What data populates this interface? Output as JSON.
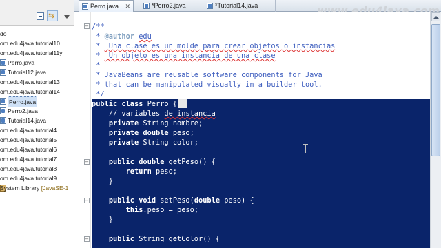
{
  "explorer": {
    "items": [
      {
        "label": "do",
        "icon": "none"
      },
      {
        "label": "om.edu4java.tutorial10",
        "icon": "package-icon"
      },
      {
        "label": "om.edu4java.tutorial11y",
        "icon": "package-icon"
      },
      {
        "label": "Perro.java",
        "icon": "java-file-icon"
      },
      {
        "label": "Tutorial12.java",
        "icon": "java-file-icon"
      },
      {
        "label": "om.edu4java.tutorial13",
        "icon": "package-icon"
      },
      {
        "label": "om.edu4java.tutorial14",
        "icon": "package-icon"
      },
      {
        "label": "Perro.java",
        "icon": "java-file-icon",
        "selected": true
      },
      {
        "label": "Perro2.java",
        "icon": "java-file-icon"
      },
      {
        "label": "Tutorial14.java",
        "icon": "java-file-icon"
      },
      {
        "label": "om.edu4java.tutorial4",
        "icon": "package-icon"
      },
      {
        "label": "om.edu4java.tutorial5",
        "icon": "package-icon"
      },
      {
        "label": "om.edu4java.tutorial6",
        "icon": "package-icon"
      },
      {
        "label": "om.edu4java.tutorial7",
        "icon": "package-icon"
      },
      {
        "label": "om.edu4java.tutorial8",
        "icon": "package-icon"
      },
      {
        "label": "om.edu4java.tutorial9",
        "icon": "package-icon"
      },
      {
        "label": "System Library",
        "icon": "library-icon",
        "suffix": "[JavaSE-1"
      }
    ]
  },
  "tabs": [
    {
      "label": "Perro.java",
      "close": "✕",
      "active": true
    },
    {
      "label": "*Perro2.java",
      "active": false
    },
    {
      "label": "*Tutorial14.java",
      "active": false
    }
  ],
  "watermark": "www.edu4java.com",
  "editor": {
    "lines": [
      {
        "segments": [
          {
            "t": "/**",
            "c": "comment"
          }
        ]
      },
      {
        "segments": [
          {
            "t": " * ",
            "c": "comment"
          },
          {
            "t": "@author",
            "c": "tag"
          },
          {
            "t": " ",
            "c": "comment"
          },
          {
            "t": "edu",
            "c": "comment-sq"
          }
        ]
      },
      {
        "segments": [
          {
            "t": " * ",
            "c": "comment"
          },
          {
            "t": " Una clase es un molde para crear objetos o instancias",
            "c": "comment-sq"
          }
        ]
      },
      {
        "segments": [
          {
            "t": " * ",
            "c": "comment"
          },
          {
            "t": " Un objeto es una instancia de una clase",
            "c": "comment-sq"
          }
        ]
      },
      {
        "segments": [
          {
            "t": " *",
            "c": "comment"
          }
        ]
      },
      {
        "segments": [
          {
            "t": " * JavaBeans are reusable software components for Java",
            "c": "comment"
          }
        ]
      },
      {
        "segments": [
          {
            "t": " * that can be manipulated visually in a builder tool.",
            "c": "comment"
          }
        ]
      },
      {
        "segments": [
          {
            "t": " */",
            "c": "comment"
          }
        ]
      },
      {
        "segments": [
          {
            "t": "public",
            "c": "kw"
          },
          {
            "t": " ",
            "c": "plain"
          },
          {
            "t": "class",
            "c": "kw"
          },
          {
            "t": " Perro {",
            "c": "plain"
          }
        ],
        "selected": true
      },
      {
        "segments": [
          {
            "t": "    // variables ",
            "c": "comment"
          },
          {
            "t": "de instancia",
            "c": "comment-sq"
          }
        ],
        "selected": true
      },
      {
        "segments": [
          {
            "t": "    ",
            "c": "plain"
          },
          {
            "t": "private",
            "c": "kw"
          },
          {
            "t": " String nombre;",
            "c": "plain"
          }
        ],
        "selected": true
      },
      {
        "segments": [
          {
            "t": "    ",
            "c": "plain"
          },
          {
            "t": "private",
            "c": "kw"
          },
          {
            "t": " ",
            "c": "plain"
          },
          {
            "t": "double",
            "c": "kw"
          },
          {
            "t": " peso;",
            "c": "plain"
          }
        ],
        "selected": true
      },
      {
        "segments": [
          {
            "t": "    ",
            "c": "plain"
          },
          {
            "t": "private",
            "c": "kw"
          },
          {
            "t": " String color;",
            "c": "plain"
          }
        ],
        "selected": true
      },
      {
        "segments": [
          {
            "t": "",
            "c": "plain"
          }
        ],
        "selected": true
      },
      {
        "segments": [
          {
            "t": "    ",
            "c": "plain"
          },
          {
            "t": "public",
            "c": "kw"
          },
          {
            "t": " ",
            "c": "plain"
          },
          {
            "t": "double",
            "c": "kw"
          },
          {
            "t": " getPeso() {",
            "c": "plain"
          }
        ],
        "selected": true
      },
      {
        "segments": [
          {
            "t": "        ",
            "c": "plain"
          },
          {
            "t": "return",
            "c": "kw"
          },
          {
            "t": " peso;",
            "c": "plain"
          }
        ],
        "selected": true
      },
      {
        "segments": [
          {
            "t": "    }",
            "c": "plain"
          }
        ],
        "selected": true
      },
      {
        "segments": [
          {
            "t": "",
            "c": "plain"
          }
        ],
        "selected": true
      },
      {
        "segments": [
          {
            "t": "    ",
            "c": "plain"
          },
          {
            "t": "public",
            "c": "kw"
          },
          {
            "t": " ",
            "c": "plain"
          },
          {
            "t": "void",
            "c": "kw"
          },
          {
            "t": " setPeso(",
            "c": "plain"
          },
          {
            "t": "double",
            "c": "kw"
          },
          {
            "t": " peso) {",
            "c": "plain"
          }
        ],
        "selected": true
      },
      {
        "segments": [
          {
            "t": "        ",
            "c": "plain"
          },
          {
            "t": "this",
            "c": "kw"
          },
          {
            "t": ".peso = peso;",
            "c": "plain"
          }
        ],
        "selected": true
      },
      {
        "segments": [
          {
            "t": "    }",
            "c": "plain"
          }
        ],
        "selected": true
      },
      {
        "segments": [
          {
            "t": "",
            "c": "plain"
          }
        ],
        "selected": true
      },
      {
        "segments": [
          {
            "t": "    ",
            "c": "plain"
          },
          {
            "t": "public",
            "c": "kw"
          },
          {
            "t": " String getColor() {",
            "c": "plain"
          }
        ],
        "selected": true
      }
    ]
  }
}
